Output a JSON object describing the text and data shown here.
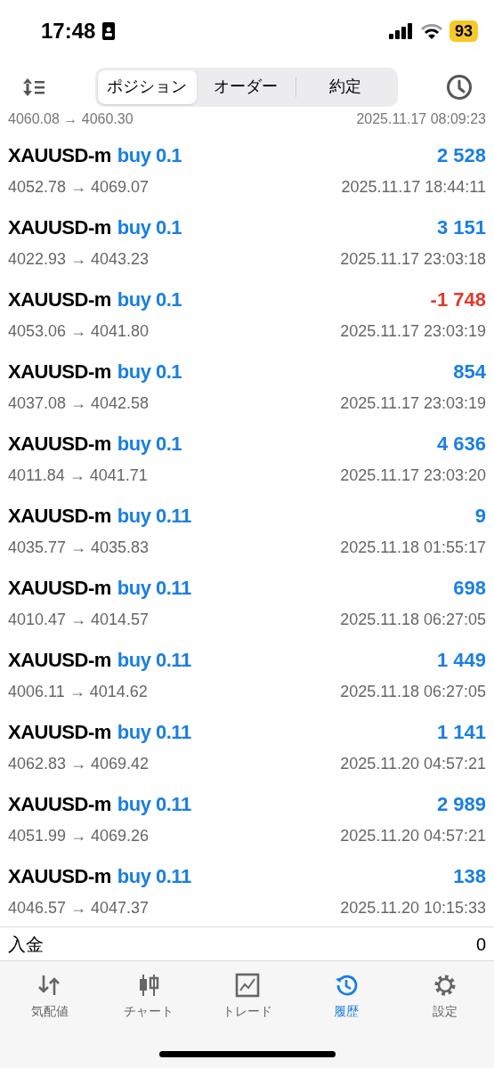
{
  "status_bar": {
    "time": "17:48",
    "battery": "93"
  },
  "segments": [
    {
      "label": "ポジション",
      "selected": true
    },
    {
      "label": "オーダー",
      "selected": false
    },
    {
      "label": "約定",
      "selected": false
    }
  ],
  "partial_row": {
    "prices": "4060.08 → 4060.30",
    "time": "2025.11.17 08:09:23"
  },
  "deals": [
    {
      "symbol": "XAUUSD-m",
      "side": "buy 0.1",
      "prices": "4052.78 → 4069.07",
      "time": "2025.11.17 18:44:11",
      "profit": "2 528",
      "loss": false
    },
    {
      "symbol": "XAUUSD-m",
      "side": "buy 0.1",
      "prices": "4022.93 → 4043.23",
      "time": "2025.11.17 23:03:18",
      "profit": "3 151",
      "loss": false
    },
    {
      "symbol": "XAUUSD-m",
      "side": "buy 0.1",
      "prices": "4053.06 → 4041.80",
      "time": "2025.11.17 23:03:19",
      "profit": "-1 748",
      "loss": true
    },
    {
      "symbol": "XAUUSD-m",
      "side": "buy 0.1",
      "prices": "4037.08 → 4042.58",
      "time": "2025.11.17 23:03:19",
      "profit": "854",
      "loss": false
    },
    {
      "symbol": "XAUUSD-m",
      "side": "buy 0.1",
      "prices": "4011.84 → 4041.71",
      "time": "2025.11.17 23:03:20",
      "profit": "4 636",
      "loss": false
    },
    {
      "symbol": "XAUUSD-m",
      "side": "buy 0.11",
      "prices": "4035.77 → 4035.83",
      "time": "2025.11.18 01:55:17",
      "profit": "9",
      "loss": false
    },
    {
      "symbol": "XAUUSD-m",
      "side": "buy 0.11",
      "prices": "4010.47 → 4014.57",
      "time": "2025.11.18 06:27:05",
      "profit": "698",
      "loss": false
    },
    {
      "symbol": "XAUUSD-m",
      "side": "buy 0.11",
      "prices": "4006.11 → 4014.62",
      "time": "2025.11.18 06:27:05",
      "profit": "1 449",
      "loss": false
    },
    {
      "symbol": "XAUUSD-m",
      "side": "buy 0.11",
      "prices": "4062.83 → 4069.42",
      "time": "2025.11.20 04:57:21",
      "profit": "1 141",
      "loss": false
    },
    {
      "symbol": "XAUUSD-m",
      "side": "buy 0.11",
      "prices": "4051.99 → 4069.26",
      "time": "2025.11.20 04:57:21",
      "profit": "2 989",
      "loss": false
    },
    {
      "symbol": "XAUUSD-m",
      "side": "buy 0.11",
      "prices": "4046.57 → 4047.37",
      "time": "2025.11.20 10:15:33",
      "profit": "138",
      "loss": false
    }
  ],
  "deposit": {
    "label": "入金",
    "value": "0"
  },
  "tab_bar": [
    {
      "kind": "quotes",
      "label": "気配値",
      "selected": false
    },
    {
      "kind": "chart",
      "label": "チャート",
      "selected": false
    },
    {
      "kind": "trade",
      "label": "トレード",
      "selected": false
    },
    {
      "kind": "history",
      "label": "履歴",
      "selected": true
    },
    {
      "kind": "settings",
      "label": "設定",
      "selected": false
    }
  ]
}
